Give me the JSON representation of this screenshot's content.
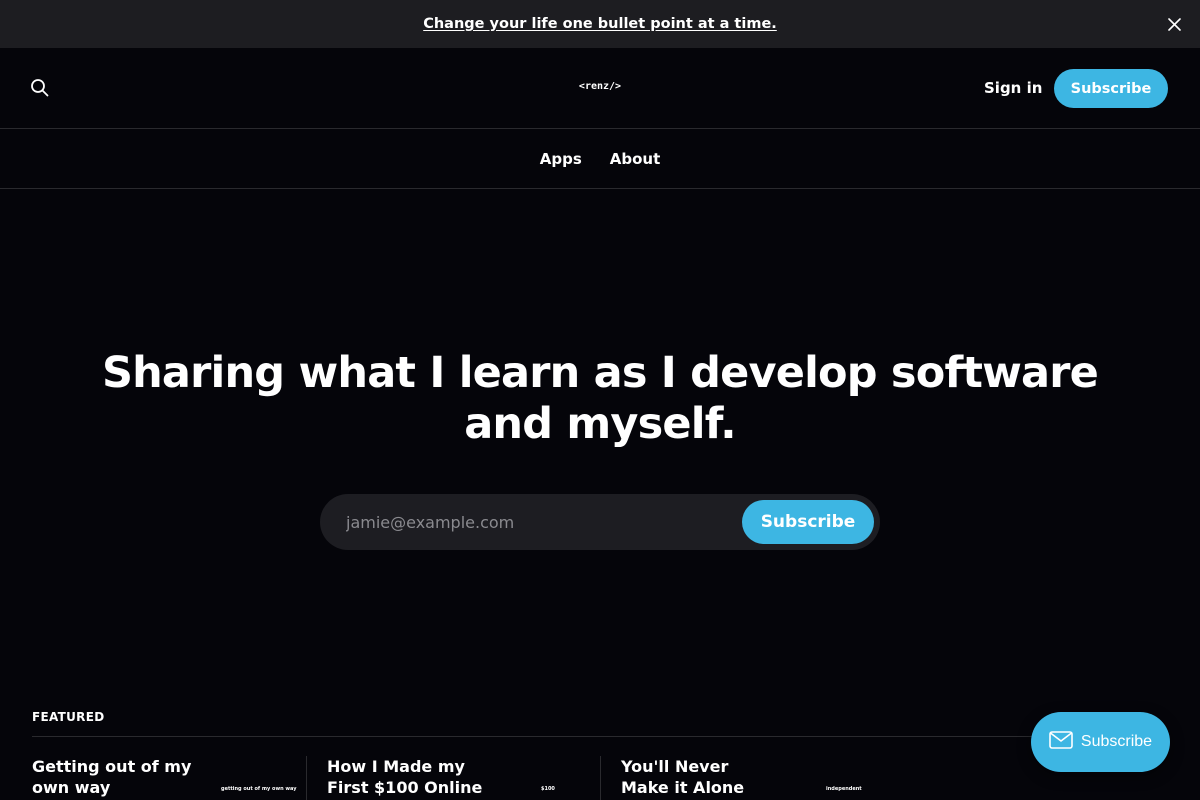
{
  "announcement": {
    "text": "Change your life one bullet point at a time."
  },
  "header": {
    "logo": "<renz/>",
    "sign_in_label": "Sign in",
    "subscribe_label": "Subscribe"
  },
  "nav": {
    "items": [
      {
        "label": "Apps"
      },
      {
        "label": "About"
      }
    ]
  },
  "hero": {
    "title": "Sharing what I learn as I develop software and myself.",
    "email_placeholder": "jamie@example.com",
    "subscribe_label": "Subscribe"
  },
  "featured": {
    "label": "FEATURED",
    "posts": [
      {
        "title": "Getting out of my own way",
        "thumb_text": "getting out of my own way"
      },
      {
        "title": "How I Made my First $100 Online",
        "thumb_text": "$100"
      },
      {
        "title": "You'll Never Make it Alone",
        "thumb_text": "independent"
      }
    ]
  },
  "portal": {
    "label": "Subscribe"
  },
  "icons": {
    "close": "close-icon",
    "search": "search-icon",
    "mail": "mail-icon"
  },
  "colors": {
    "background": "#05050a",
    "accent": "#3db6e3",
    "announcement_bg": "#1d1d21"
  }
}
